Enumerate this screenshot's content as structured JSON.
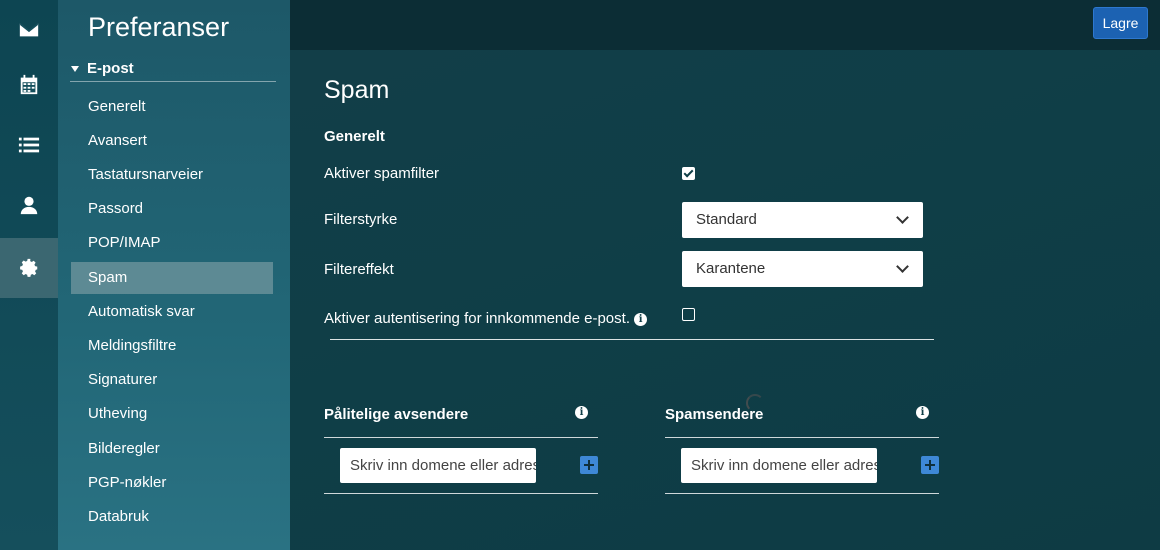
{
  "rail": {
    "items": [
      {
        "icon": "mail-icon"
      },
      {
        "icon": "calendar-icon"
      },
      {
        "icon": "list-icon"
      },
      {
        "icon": "user-icon"
      },
      {
        "icon": "gear-icon",
        "active": true
      }
    ]
  },
  "sidebar": {
    "title": "Preferanser",
    "section": "E-post",
    "items": [
      {
        "label": "Generelt"
      },
      {
        "label": "Avansert"
      },
      {
        "label": "Tastatursnarveier"
      },
      {
        "label": "Passord"
      },
      {
        "label": "POP/IMAP"
      },
      {
        "label": "Spam",
        "active": true
      },
      {
        "label": "Automatisk svar"
      },
      {
        "label": "Meldingsfiltre"
      },
      {
        "label": "Signaturer"
      },
      {
        "label": "Utheving"
      },
      {
        "label": "Bilderegler"
      },
      {
        "label": "PGP-nøkler"
      },
      {
        "label": "Databruk"
      }
    ]
  },
  "toolbar": {
    "save_label": "Lagre"
  },
  "main": {
    "title": "Spam",
    "subhead": "Generelt",
    "enable_spam_filter": {
      "label": "Aktiver spamfilter",
      "checked": true
    },
    "filter_strength": {
      "label": "Filterstyrke",
      "value": "Standard"
    },
    "filter_effect": {
      "label": "Filtereffekt",
      "value": "Karantene"
    },
    "enable_auth": {
      "label": "Aktiver autentisering for innkommende e-post.",
      "checked": false
    },
    "trusted_senders": {
      "label": "Pålitelige avsendere",
      "placeholder": "Skriv inn domene eller adresse"
    },
    "spam_senders": {
      "label": "Spamsendere",
      "placeholder": "Skriv inn domene eller adresse"
    }
  },
  "colors": {
    "accent": "#1c62b2",
    "active_nav": "#5d8a94",
    "background": "#0f3e47"
  }
}
